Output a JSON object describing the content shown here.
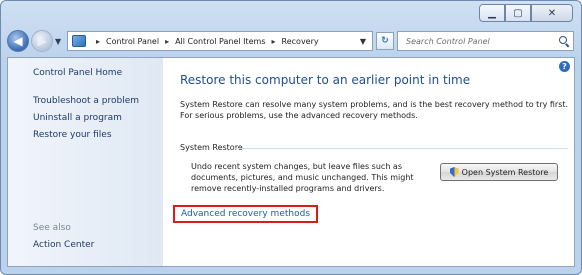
{
  "nav": {
    "back_icon": "back-arrow-icon",
    "forward_icon": "forward-arrow-icon",
    "breadcrumb": [
      "Control Panel",
      "All Control Panel Items",
      "Recovery"
    ],
    "search_placeholder": "Search Control Panel"
  },
  "sidebar": {
    "home": "Control Panel Home",
    "links": [
      "Troubleshoot a problem",
      "Uninstall a program",
      "Restore your files"
    ],
    "see_also_label": "See also",
    "see_also_links": [
      "Action Center"
    ]
  },
  "main": {
    "title": "Restore this computer to an earlier point in time",
    "description": "System Restore can resolve many system problems, and is the best recovery method to try first. For serious problems, use the advanced recovery methods.",
    "section_title": "System Restore",
    "section_text": "Undo recent system changes, but leave files such as documents, pictures, and music unchanged. This might remove recently-installed programs and drivers.",
    "open_button": "Open System Restore",
    "advanced_link": "Advanced recovery methods"
  },
  "colors": {
    "link": "#1c5bbf",
    "title": "#1e4d93",
    "highlight_border": "#e01a1a"
  }
}
